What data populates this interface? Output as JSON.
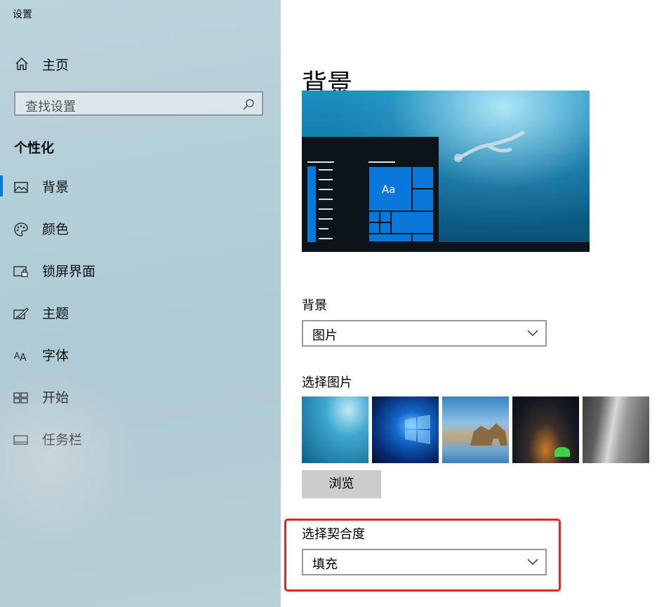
{
  "app": {
    "title": "设置"
  },
  "sidebar": {
    "home_label": "主页",
    "search_placeholder": "查找设置",
    "section_title": "个性化",
    "items": [
      {
        "label": "背景",
        "icon": "picture-icon",
        "active": true
      },
      {
        "label": "颜色",
        "icon": "palette-icon",
        "active": false
      },
      {
        "label": "锁屏界面",
        "icon": "lock-screen-icon",
        "active": false
      },
      {
        "label": "主题",
        "icon": "brush-icon",
        "active": false
      },
      {
        "label": "字体",
        "icon": "font-icon",
        "active": false
      },
      {
        "label": "开始",
        "icon": "start-icon",
        "active": false
      },
      {
        "label": "任务栏",
        "icon": "taskbar-icon",
        "active": false
      }
    ]
  },
  "main": {
    "page_title": "背景",
    "preview_tile_text": "Aa",
    "background_label": "背景",
    "background_value": "图片",
    "choose_picture_label": "选择图片",
    "browse_label": "浏览",
    "fit_label": "选择契合度",
    "fit_value": "填充"
  },
  "colors": {
    "accent": "#0078d7",
    "highlight": "#e3241f"
  }
}
